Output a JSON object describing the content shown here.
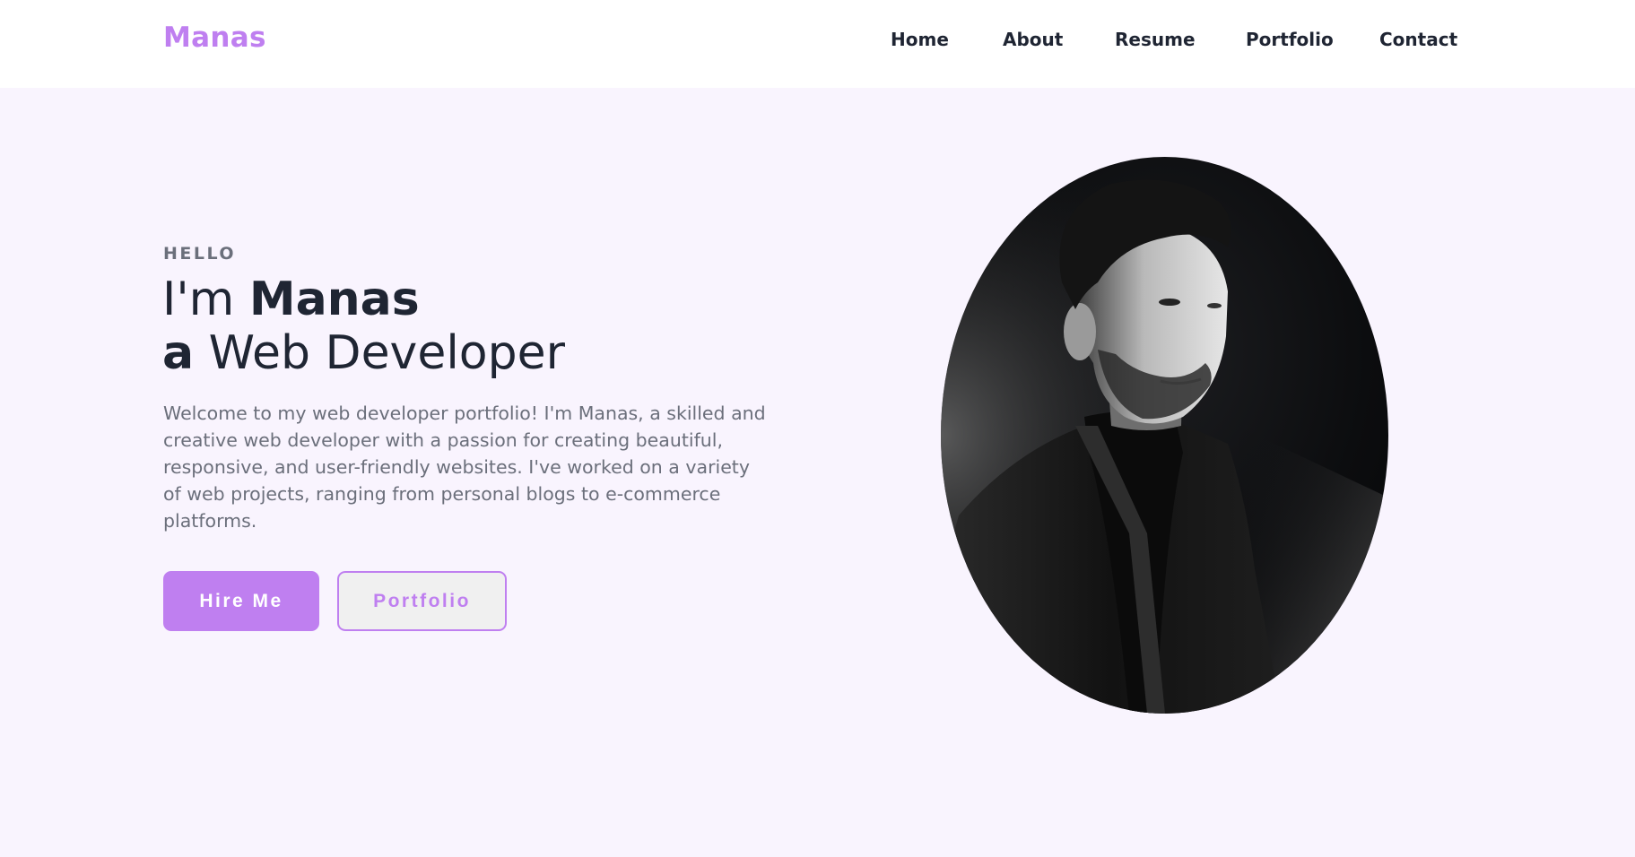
{
  "header": {
    "logo": "Manas",
    "nav": [
      {
        "label": "Home"
      },
      {
        "label": "About"
      },
      {
        "label": "Resume"
      },
      {
        "label": "Portfolio"
      },
      {
        "label": "Contact"
      }
    ]
  },
  "hero": {
    "greeting": "HELLO",
    "headline_line1_prefix": "I'm ",
    "headline_name": "Manas",
    "headline_line2_prefix": "a",
    "headline_role": " Web Developer",
    "intro": "Welcome to my web developer portfolio! I'm Manas, a skilled and creative web developer with a passion for creating beautiful, responsive, and user-friendly websites. I've worked on a variety of web projects, ranging from personal blogs to e-commerce platforms.",
    "hire_button": "Hire Me",
    "portfolio_button": "Portfolio"
  },
  "colors": {
    "accent": "#bf7ff0",
    "hero_background": "#f9f4fe",
    "text_dark": "#1f2533",
    "text_muted": "#6b6f7b"
  }
}
